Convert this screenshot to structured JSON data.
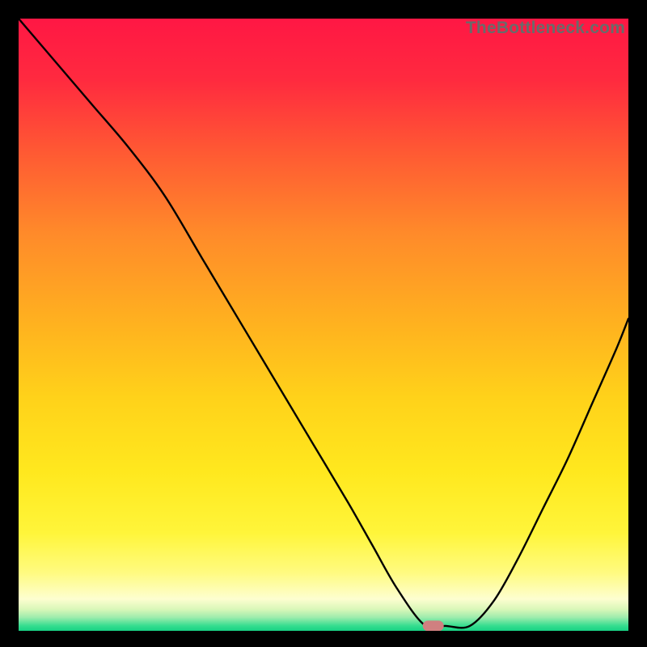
{
  "watermark": "TheBottleneck.com",
  "chart_data": {
    "type": "line",
    "title": "",
    "xlabel": "",
    "ylabel": "",
    "xlim": [
      0,
      100
    ],
    "ylim": [
      0,
      100
    ],
    "grid": false,
    "note": "Axes are unlabeled; x and y treated as 0–100 percent of plot area. y-values are read as distance from the bottom (0 = bottom, 100 = top).",
    "series": [
      {
        "name": "curve",
        "x": [
          0,
          6,
          12,
          18,
          24,
          30,
          36,
          42,
          48,
          54,
          58,
          62,
          66.5,
          70,
          74,
          78,
          82,
          86,
          90,
          94,
          98,
          100
        ],
        "y": [
          100,
          93,
          86,
          79,
          71,
          61,
          51,
          41,
          31,
          21,
          14,
          7,
          1,
          0.8,
          0.8,
          5,
          12,
          20,
          28,
          37,
          46,
          51
        ]
      }
    ],
    "marker": {
      "name": "marker-point",
      "x": 68,
      "y": 0.8,
      "color": "#d08080",
      "shape": "capsule"
    },
    "gradient_stops": [
      {
        "offset": 0.0,
        "color": "#ff1744"
      },
      {
        "offset": 0.1,
        "color": "#ff2a3f"
      },
      {
        "offset": 0.22,
        "color": "#ff5a33"
      },
      {
        "offset": 0.35,
        "color": "#ff8a2a"
      },
      {
        "offset": 0.5,
        "color": "#ffb21f"
      },
      {
        "offset": 0.62,
        "color": "#ffd21a"
      },
      {
        "offset": 0.74,
        "color": "#ffe81e"
      },
      {
        "offset": 0.84,
        "color": "#fff53a"
      },
      {
        "offset": 0.905,
        "color": "#fffb80"
      },
      {
        "offset": 0.948,
        "color": "#fdfed0"
      },
      {
        "offset": 0.965,
        "color": "#d9f7b8"
      },
      {
        "offset": 0.978,
        "color": "#9eecad"
      },
      {
        "offset": 0.992,
        "color": "#34dd8f"
      },
      {
        "offset": 1.0,
        "color": "#18d184"
      }
    ]
  }
}
